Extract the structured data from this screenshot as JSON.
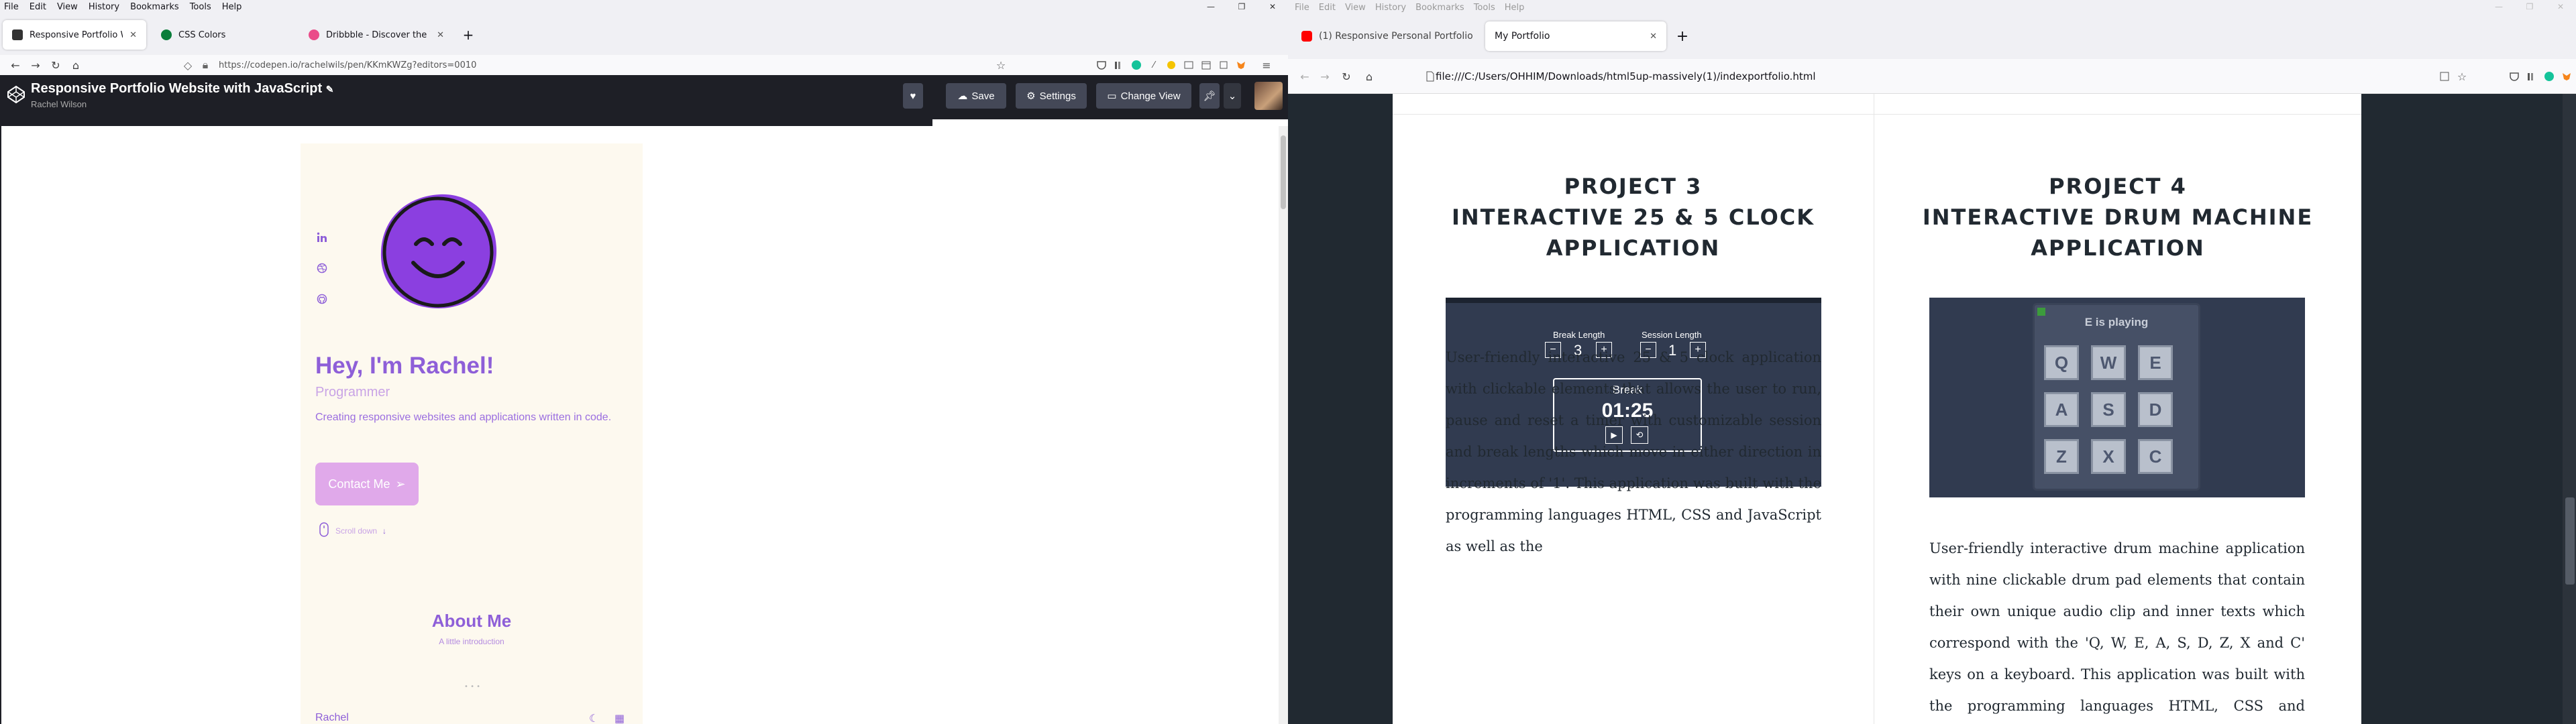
{
  "left": {
    "menu": [
      "File",
      "Edit",
      "View",
      "History",
      "Bookmarks",
      "Tools",
      "Help"
    ],
    "tabs": [
      {
        "title": "Responsive Portfolio Website w",
        "color": "#333333"
      },
      {
        "title": "CSS Colors",
        "color": "#0a7d3a"
      },
      {
        "title": "Dribbble - Discover the World's",
        "color": "#ea4c89"
      }
    ],
    "url": "https://codepen.io/rachelwils/pen/KKmKWZg?editors=0010",
    "codepen": {
      "title": "Responsive Portfolio Website with JavaScript",
      "user": "Rachel Wilson",
      "save": "Save",
      "settings": "Settings",
      "change_view": "Change View"
    },
    "portfolio": {
      "greeting": "Hey, I'm Rachel!",
      "role": "Programmer",
      "description": "Creating responsive websites and applications written in code.",
      "contact": "Contact Me",
      "scroll": "Scroll down",
      "about_title": "About Me",
      "about_sub": "A little introduction",
      "footer_name": "Rachel"
    },
    "colors": {
      "accent": "#8e5fd8",
      "card_bg": "#fdf9ef",
      "contact_bg": "#e0a9ea"
    }
  },
  "right": {
    "menu": [
      "File",
      "Edit",
      "View",
      "History",
      "Bookmarks",
      "Tools",
      "Help"
    ],
    "tabs": [
      {
        "title": "(1) Responsive Personal Portfolio",
        "color": "#ff0000"
      },
      {
        "title": "My Portfolio",
        "color": "#cccccc"
      }
    ],
    "url": "file:///C:/Users/OHHIM/Downloads/html5up-massively(1)/indexportfolio.html",
    "project3": {
      "title": [
        "PROJECT 3",
        "INTERACTIVE 25 & 5 CLOCK",
        "APPLICATION"
      ],
      "break_length_label": "Break Length",
      "session_length_label": "Session Length",
      "break_length": "3",
      "session_length": "1",
      "timer_label": "Break",
      "timer": "01:25",
      "text": "User-friendly interactive 25 & 5 clock application with clickable elements that allows the user to run, pause and reset a timer with customizable session and break lengths which move in either direction in increments of '1'. This application was built with the programming languages HTML, CSS and JavaScript as well as the"
    },
    "project4": {
      "title": [
        "PROJECT 4",
        "INTERACTIVE DRUM MACHINE",
        "APPLICATION"
      ],
      "display": "E is playing",
      "pads": [
        "Q",
        "W",
        "E",
        "A",
        "S",
        "D",
        "Z",
        "X",
        "C"
      ],
      "text": "User-friendly interactive drum machine application with nine clickable drum pad elements that contain their own unique audio clip and inner texts which correspond with the 'Q, W, E, A, S, D, Z, X and C' keys on a keyboard. This application was built with the programming languages HTML, CSS and JavaScript as well as the frontend"
    }
  }
}
